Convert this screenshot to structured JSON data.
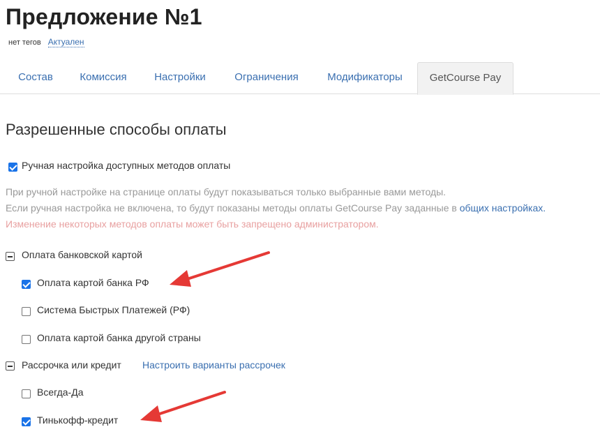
{
  "header": {
    "title": "Предложение №1",
    "tags": "нет тегов",
    "status": "Актуален"
  },
  "tabs": [
    {
      "label": "Состав",
      "active": false
    },
    {
      "label": "Комиссия",
      "active": false
    },
    {
      "label": "Настройки",
      "active": false
    },
    {
      "label": "Ограничения",
      "active": false
    },
    {
      "label": "Модификаторы",
      "active": false
    },
    {
      "label": "GetCourse Pay",
      "active": true
    }
  ],
  "section": {
    "title": "Разрешенные способы оплаты",
    "manual_toggle": {
      "label": "Ручная настройка доступных методов оплаты",
      "checked": true
    },
    "help_line1": "При ручной настройке на странице оплаты будут показываться только выбранные вами методы.",
    "help_line2": "Если ручная настройка не включена, то будут показаны методы оплаты GetCourse Pay заданные в",
    "help_link": "общих настройках.",
    "warning": "Изменение некоторых методов оплаты может быть запрещено администратором."
  },
  "groups": {
    "card": {
      "label": "Оплата банковской картой",
      "items": [
        {
          "label": "Оплата картой банка РФ",
          "checked": true
        },
        {
          "label": "Система Быстрых Платежей (РФ)",
          "checked": false
        },
        {
          "label": "Оплатa картой банка другой страны",
          "checked": false
        }
      ]
    },
    "credit": {
      "label": "Рассрочка или кредит",
      "link": "Настроить варианты рассрочек",
      "items": [
        {
          "label": "Всегда-Да",
          "checked": false
        },
        {
          "label": "Тинькофф-кредит",
          "checked": true
        }
      ]
    }
  },
  "colors": {
    "accent": "#3a6fb0",
    "checkbox": "#1a73e8",
    "arrow": "#e53935",
    "warning": "#e8a0a0"
  }
}
